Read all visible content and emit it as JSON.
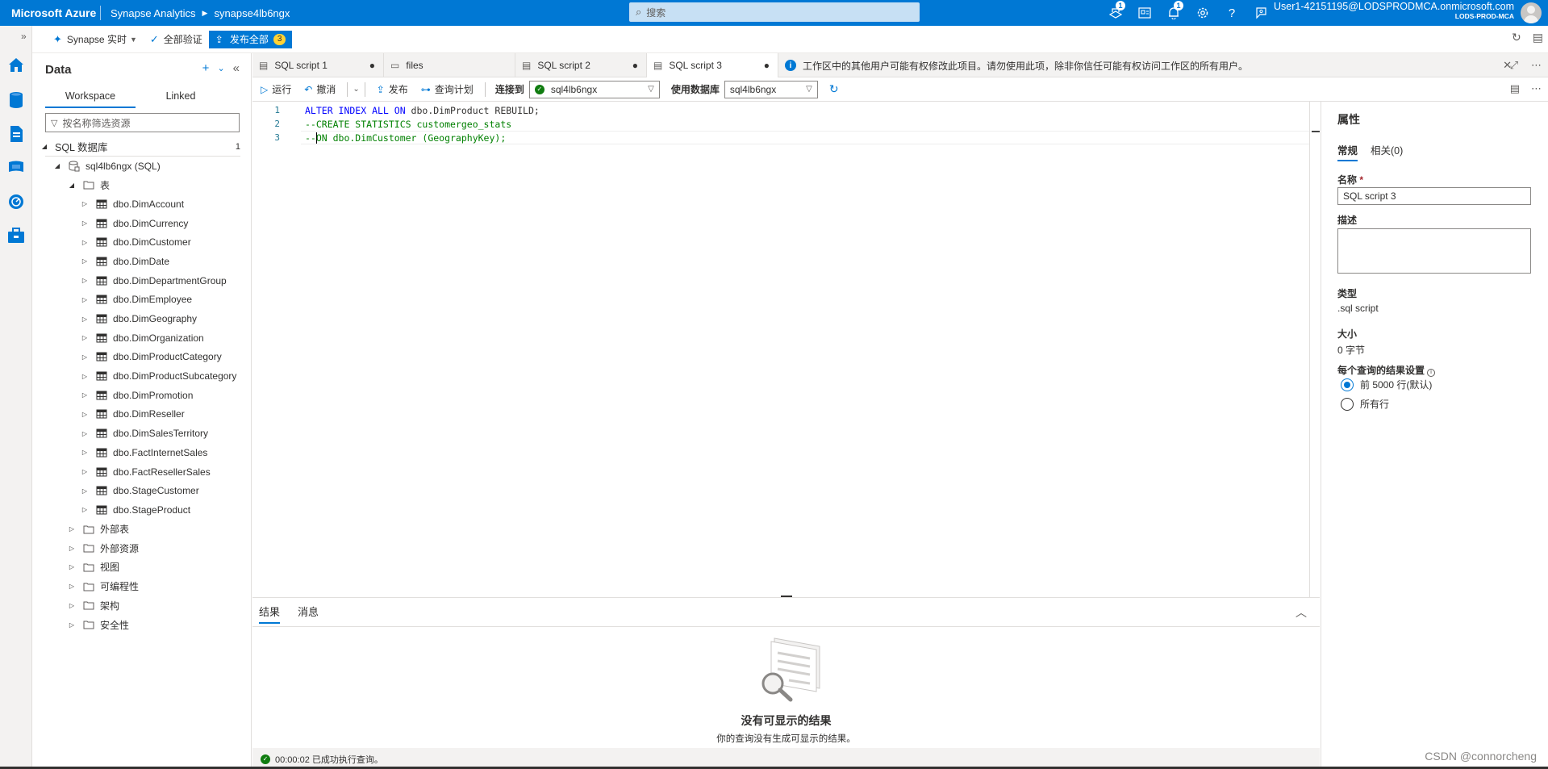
{
  "topbar": {
    "brand": "Microsoft Azure",
    "crumbs": [
      "Synapse Analytics",
      "synapse4lb6ngx"
    ],
    "search_placeholder": "搜索",
    "badges": {
      "notify_cloud": "1",
      "bell": "1"
    },
    "user_email": "User1-42151195@LODSPRODMCA.onmicrosoft.com",
    "user_tenant": "LODS-PROD-MCA"
  },
  "cmdbar": {
    "live": "Synapse 实时",
    "validate_all": "全部验证",
    "publish_all": "发布全部",
    "publish_count": "3"
  },
  "datapanel": {
    "title": "Data",
    "tabs": [
      "Workspace",
      "Linked"
    ],
    "filter_placeholder": "按名称筛选资源",
    "section": "SQL 数据库",
    "section_count": "1",
    "db": "sql4lb6ngx (SQL)",
    "tables_folder": "表",
    "tables": [
      "dbo.DimAccount",
      "dbo.DimCurrency",
      "dbo.DimCustomer",
      "dbo.DimDate",
      "dbo.DimDepartmentGroup",
      "dbo.DimEmployee",
      "dbo.DimGeography",
      "dbo.DimOrganization",
      "dbo.DimProductCategory",
      "dbo.DimProductSubcategory",
      "dbo.DimPromotion",
      "dbo.DimReseller",
      "dbo.DimSalesTerritory",
      "dbo.FactInternetSales",
      "dbo.FactResellerSales",
      "dbo.StageCustomer",
      "dbo.StageProduct"
    ],
    "folders": [
      "外部表",
      "外部资源",
      "视图",
      "可编程性",
      "架构",
      "安全性"
    ]
  },
  "tabs": [
    {
      "label": "SQL script 1",
      "icon": "script-icon",
      "dirty": "●"
    },
    {
      "label": "files",
      "icon": "folder-icon",
      "dirty": ""
    },
    {
      "label": "SQL script 2",
      "icon": "script-icon",
      "dirty": "●"
    },
    {
      "label": "SQL script 3",
      "icon": "script-icon",
      "dirty": "●"
    }
  ],
  "warning": "工作区中的其他用户可能有权修改此项目。请勿使用此项，除非你信任可能有权访问工作区的所有用户。",
  "toolbar": {
    "run": "运行",
    "undo": "撤消",
    "publish": "发布",
    "query_plan": "查询计划",
    "connect_label": "连接到",
    "connect_value": "sql4lb6ngx",
    "db_label": "使用数据库",
    "db_value": "sql4lb6ngx"
  },
  "editor": {
    "lines": [
      {
        "n": "1",
        "kw": "ALTER INDEX ALL ON",
        "rest": " dbo.DimProduct REBUILD;",
        "comment": ""
      },
      {
        "n": "2",
        "kw": "",
        "rest": "",
        "comment": "--CREATE STATISTICS customergeo_stats"
      },
      {
        "n": "3",
        "kw": "",
        "rest": "",
        "comment": "--ON dbo.DimCustomer (GeographyKey);"
      }
    ]
  },
  "results": {
    "tabs": [
      "结果",
      "消息"
    ],
    "empty_title": "没有可显示的结果",
    "empty_sub": "你的查询没有生成可显示的结果。",
    "status": "00:00:02 已成功执行查询。"
  },
  "properties": {
    "title": "属性",
    "tabs": [
      "常规",
      "相关(0)"
    ],
    "name_label": "名称",
    "required_mark": "*",
    "name_value": "SQL script 3",
    "desc_label": "描述",
    "type_label": "类型",
    "type_value": ".sql script",
    "size_label": "大小",
    "size_value": "0 字节",
    "result_setting_label": "每个查询的结果设置",
    "option_default": "前 5000 行(默认)",
    "option_all": "所有行"
  },
  "watermark": "CSDN @connorcheng",
  "colors": {
    "accent": "#0078d4",
    "success": "#107c10",
    "badge": "#ffd335"
  }
}
